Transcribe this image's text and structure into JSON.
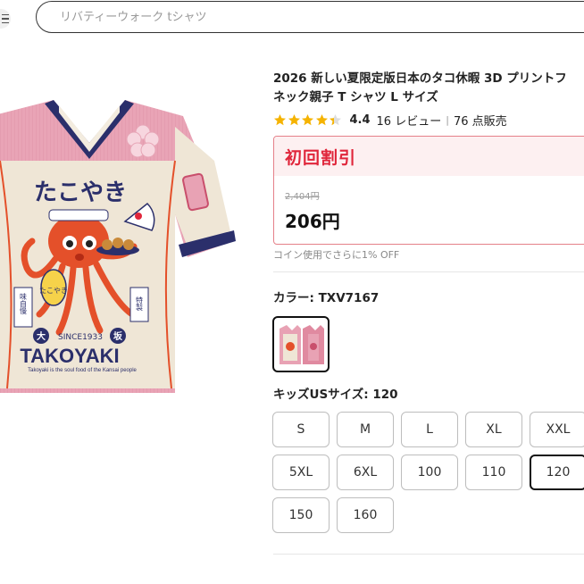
{
  "search": {
    "placeholder": "リバティーウォーク tシャツ"
  },
  "product": {
    "title_line1": "2026 新しい夏限定版日本のタコ休暇 3D プリントフ",
    "title_line2": "ネック親子 T シャツ L サイズ",
    "rating": "4.4",
    "rating_value": 4.4,
    "reviews": "16 レビュー",
    "separator": "|",
    "sold": "76 点販売",
    "image": {
      "brand_jp": "たこやき",
      "since": "SINCE1933",
      "big_char_left": "大",
      "big_char_right": "坂",
      "name": "TAKOYAKI",
      "tagline": "Takoyaki is the soul food of the Kansai people",
      "side_left": "味自慢",
      "side_right": "特製",
      "lantern": "たこやき"
    }
  },
  "promo": {
    "title": "初回割引",
    "old_price": "2,404円",
    "new_price": "206円"
  },
  "coin_note": "コイン使用でさらに1% OFF",
  "color": {
    "label": "カラー: TXV7167"
  },
  "size": {
    "label": "キッズUSサイズ: 120",
    "options": [
      "S",
      "M",
      "L",
      "XL",
      "XXL",
      "5XL",
      "6XL",
      "100",
      "110",
      "120",
      "150",
      "160"
    ],
    "selected": "120"
  },
  "colors": {
    "accent_red": "#e0263b",
    "promo_bg": "#fdf0f1",
    "star": "#f5b301",
    "shirt_pink": "#e8a2b4",
    "shirt_cream": "#efe6d6",
    "collar_navy": "#2b2f6b",
    "octopus": "#e4502a"
  }
}
